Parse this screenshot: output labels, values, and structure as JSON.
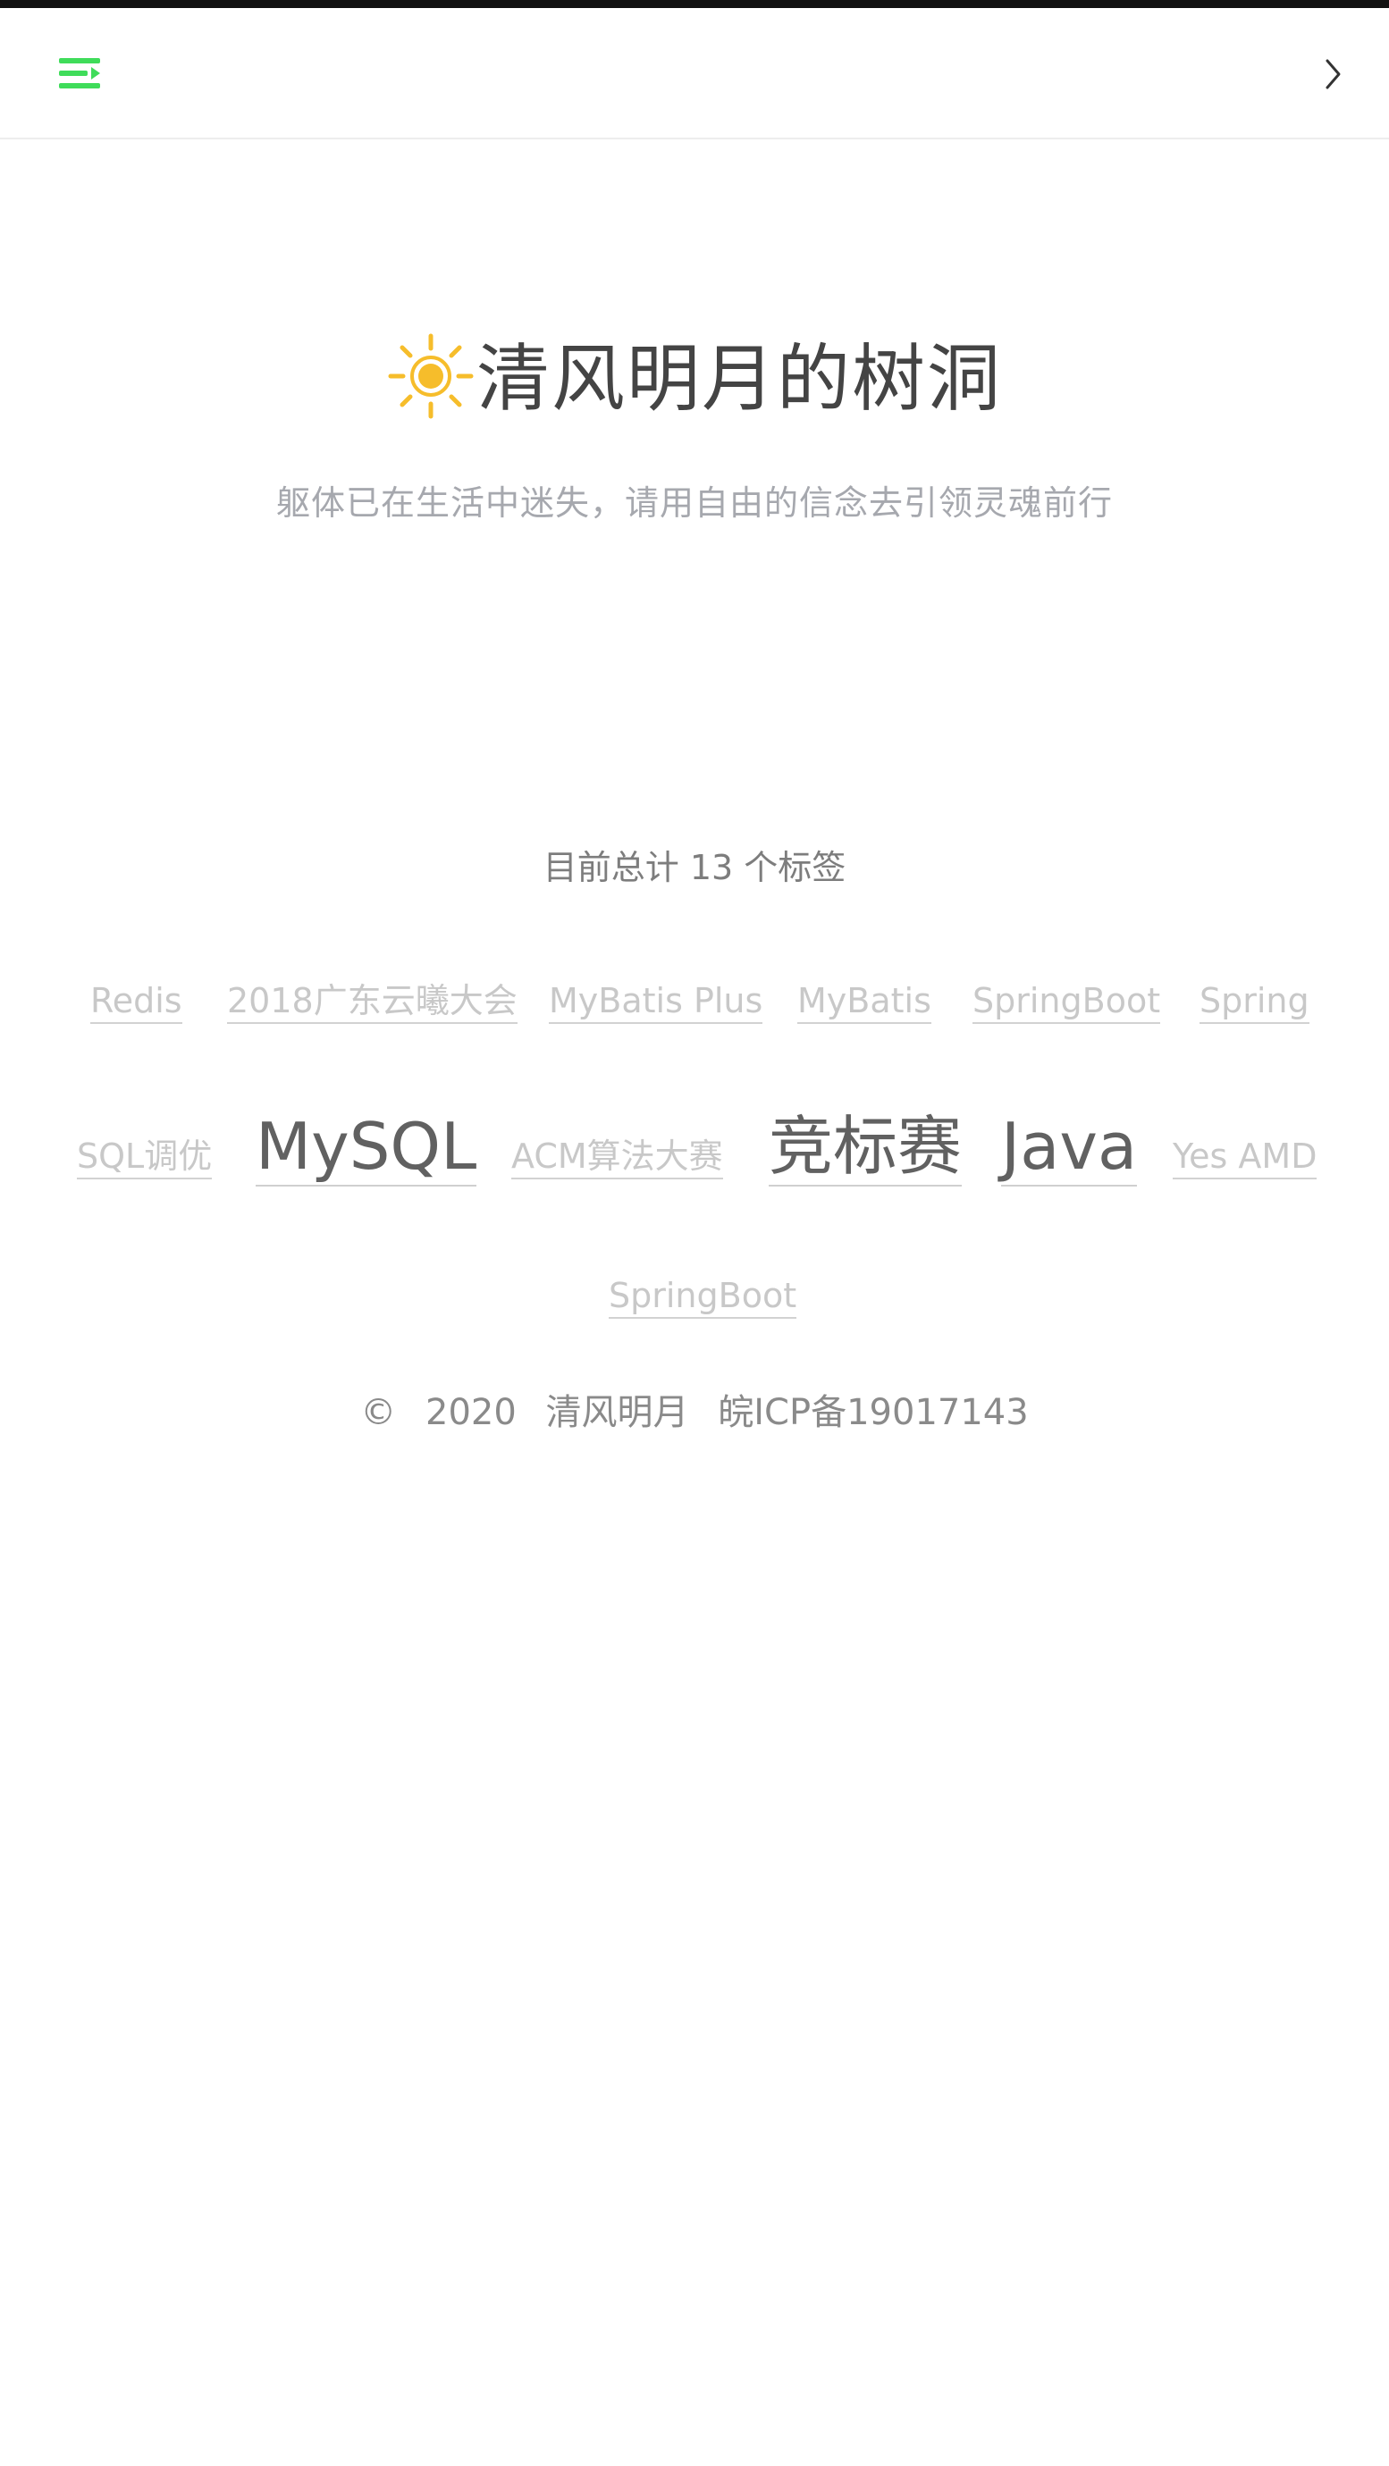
{
  "header": {
    "menu_icon": "menu-toggle-icon",
    "next_icon": "chevron-right-icon",
    "accent_color": "#3fdc5a"
  },
  "brand": {
    "icon": "sun-icon",
    "icon_color": "#f6bd2b",
    "title": "清风明月的树洞",
    "subtitle": "躯体已在生活中迷失，请用自由的信念去引领灵魂前行"
  },
  "tags_page": {
    "summary": "目前总计 13 个标签",
    "tags": [
      {
        "label": "Redis",
        "weight": "small"
      },
      {
        "label": "2018广东云曦大会",
        "weight": "small"
      },
      {
        "label": "MyBatis Plus",
        "weight": "small"
      },
      {
        "label": "MyBatis",
        "weight": "small"
      },
      {
        "label": "SpringBoot",
        "weight": "small"
      },
      {
        "label": "Spring",
        "weight": "small"
      },
      {
        "label": "SQL调优",
        "weight": "small"
      },
      {
        "label": "MySQL",
        "weight": "big"
      },
      {
        "label": "ACM算法大赛",
        "weight": "small"
      },
      {
        "label": "竞标赛",
        "weight": "big"
      },
      {
        "label": "Java",
        "weight": "big"
      },
      {
        "label": "Yes AMD",
        "weight": "small"
      },
      {
        "label": "SpringBoot",
        "weight": "small"
      }
    ]
  },
  "footer": {
    "copyright": "©",
    "year": "2020",
    "owner": "清风明月",
    "icp": "皖ICP备19017143"
  }
}
